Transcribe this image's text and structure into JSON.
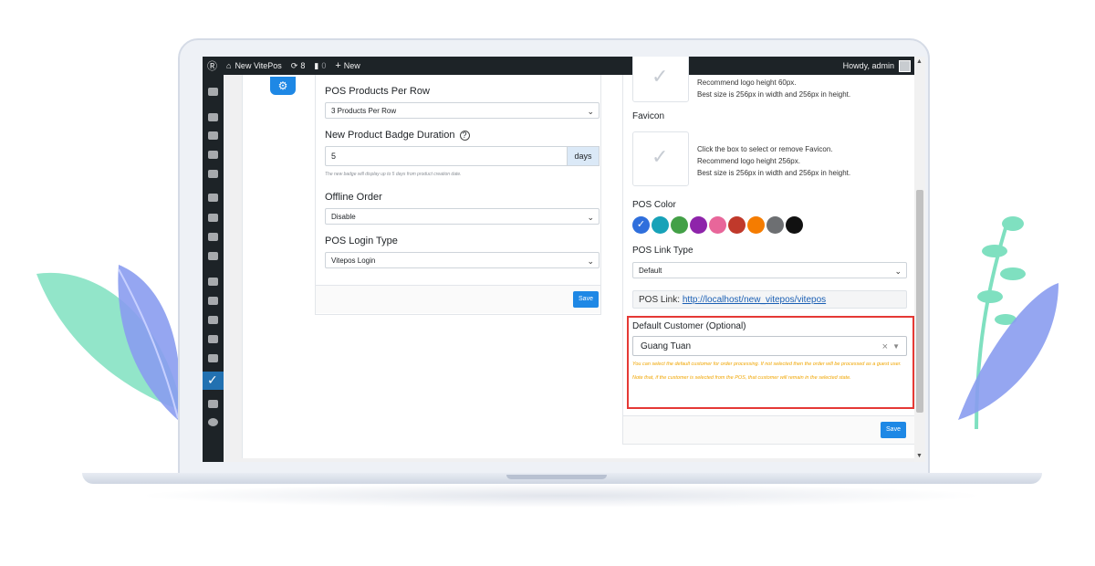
{
  "adminbar": {
    "site_name": "New VitePos",
    "updates_count": "8",
    "comments_count": "0",
    "new_label": "New",
    "howdy": "Howdy, admin"
  },
  "left_card": {
    "products_per_row_label": "POS Products Per Row",
    "products_per_row_value": "3 Products Per Row",
    "badge_duration_label": "New Product Badge Duration",
    "badge_duration_value": "5",
    "badge_duration_unit": "days",
    "badge_help": "The new badge will display up to 5 days from product creation date.",
    "offline_order_label": "Offline Order",
    "offline_order_value": "Disable",
    "login_type_label": "POS Login Type",
    "login_type_value": "Vitepos Login",
    "save_label": "Save"
  },
  "right_card": {
    "logo_info": [
      "Recommend logo height 60px.",
      "Best size is 256px in width and 256px in height."
    ],
    "favicon_label": "Favicon",
    "favicon_info": [
      "Click the box to select or remove Favicon.",
      "Recommend logo height 256px.",
      "Best size is 256px in width and 256px in height."
    ],
    "pos_color_label": "POS Color",
    "colors": [
      "#2f6fdc",
      "#17a2b8",
      "#43a047",
      "#8e24aa",
      "#e8669a",
      "#c0392b",
      "#f57c00",
      "#6d6f72",
      "#111111"
    ],
    "link_type_label": "POS Link Type",
    "link_type_value": "Default",
    "pos_link_label": "POS Link:",
    "pos_link_url": "http://localhost/new_vitepos/vitepos",
    "default_customer_label": "Default Customer (Optional)",
    "default_customer_value": "Guang Tuan",
    "default_customer_help": "You can select the default customer for order processing. If not selected then the order will be processed as a guest user. Note that, if the customer is selected from the POS, that customer will remain in the selected state.",
    "save_label": "Save"
  },
  "accent_colors": {
    "primary": "#1e88e5",
    "highlight": "#e53935",
    "admin_dark": "#1d2327"
  }
}
